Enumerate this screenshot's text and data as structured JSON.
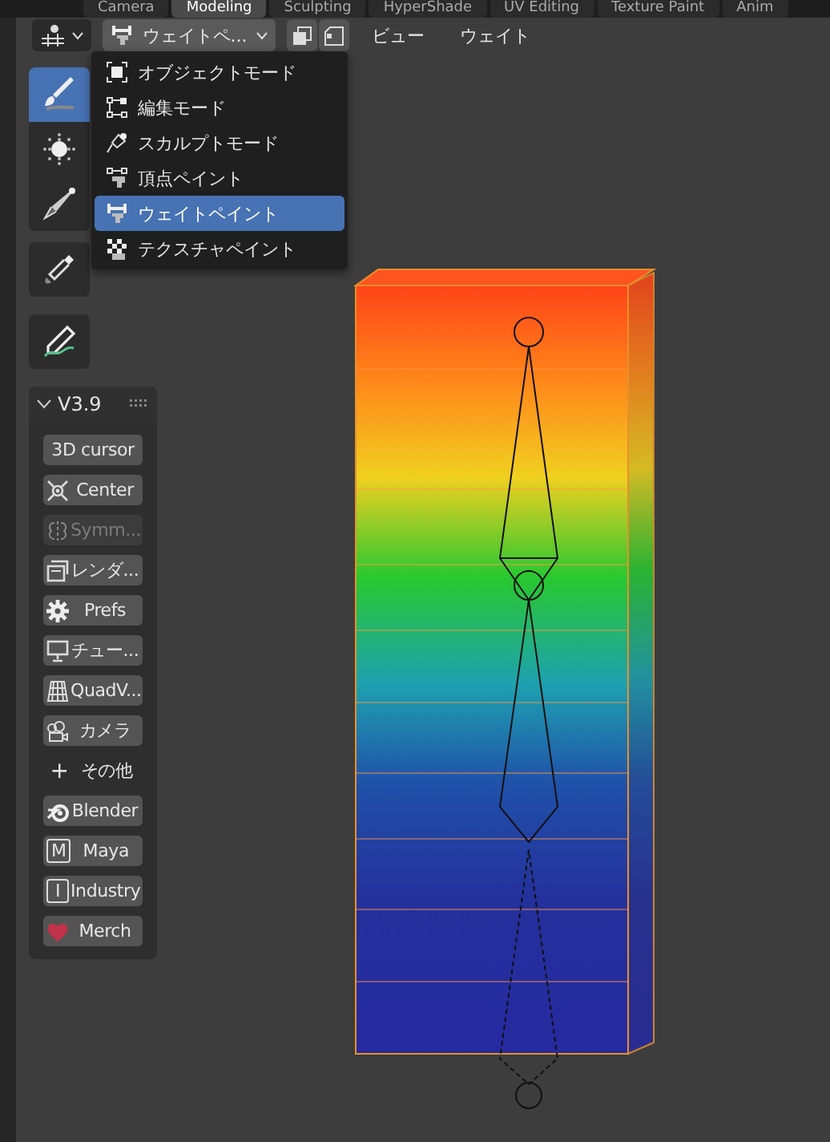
{
  "workspace_tabs": [
    {
      "label": "Camera",
      "selected": false
    },
    {
      "label": "Modeling",
      "selected": true
    },
    {
      "label": "Sculpting",
      "selected": false
    },
    {
      "label": "HyperShade",
      "selected": false
    },
    {
      "label": "UV Editing",
      "selected": false
    },
    {
      "label": "Texture Paint",
      "selected": false
    },
    {
      "label": "Anim",
      "selected": false
    }
  ],
  "header": {
    "mode": "ウェイトペ...",
    "menus": [
      "ビュー",
      "ウェイト"
    ]
  },
  "mode_menu": {
    "items": [
      {
        "label": "オブジェクトモード",
        "selected": false
      },
      {
        "label": "編集モード",
        "selected": false
      },
      {
        "label": "スカルプトモード",
        "selected": false
      },
      {
        "label": "頂点ペイント",
        "selected": false
      },
      {
        "label": "ウェイトペイント",
        "selected": true
      },
      {
        "label": "テクスチャペイント",
        "selected": false
      }
    ]
  },
  "toolbar": {
    "groups": [
      [
        {
          "selected": true
        },
        {
          "selected": false
        },
        {
          "selected": false
        }
      ],
      [
        {
          "selected": false
        }
      ],
      [
        {
          "selected": false
        }
      ]
    ]
  },
  "panel": {
    "title": "V3.9",
    "expanded": true,
    "buttons": [
      {
        "kind": "button",
        "label": "3D cursor",
        "disabled": false
      },
      {
        "kind": "button",
        "label": "Center",
        "disabled": false
      },
      {
        "kind": "button",
        "label": "Symm...",
        "disabled": true
      },
      {
        "kind": "button",
        "label": "レンダ...",
        "disabled": false
      },
      {
        "kind": "button",
        "label": "Prefs",
        "disabled": false
      },
      {
        "kind": "button",
        "label": "チュー...",
        "disabled": false
      },
      {
        "kind": "button",
        "label": "QuadV...",
        "disabled": false
      },
      {
        "kind": "button",
        "label": "カメラ",
        "disabled": false
      },
      {
        "kind": "plain",
        "glyph": "+",
        "label": "その他",
        "disabled": false
      },
      {
        "kind": "button",
        "label": "Blender",
        "disabled": false
      },
      {
        "kind": "button",
        "glyph": "M",
        "label": "Maya",
        "disabled": false
      },
      {
        "kind": "button",
        "glyph": "I",
        "label": "Industry",
        "disabled": false
      },
      {
        "kind": "button",
        "label": "Merch",
        "disabled": false
      }
    ]
  }
}
